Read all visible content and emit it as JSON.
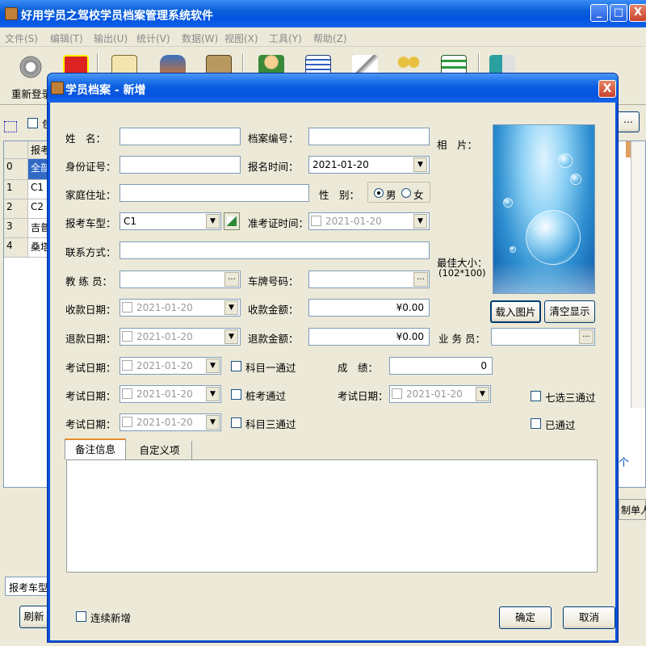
{
  "app": {
    "title": "好用学员之驾校学员档案管理系统软件",
    "window_controls": {
      "minimize": "_",
      "maximize": "□",
      "close": "X"
    },
    "menus": [
      "文件(S)",
      "编辑(T)",
      "输出(U)",
      "统计(V)",
      "数据(W)",
      "视图(X)",
      "工具(Y)",
      "帮助(Z)"
    ],
    "toolbar": {
      "relogin": "重新登录"
    }
  },
  "background": {
    "checkbox_label": "包",
    "ellipsis": "...",
    "grid_header": "报考",
    "grid_rows": [
      {
        "index": "0",
        "value": "全部"
      },
      {
        "index": "1",
        "value": "C1"
      },
      {
        "index": "2",
        "value": "C2"
      },
      {
        "index": "3",
        "value": "吉普"
      },
      {
        "index": "4",
        "value": "桑塔"
      }
    ],
    "right_link": "个",
    "right_header": "制单人",
    "bottom_field": "报考车型",
    "refresh_button": "刷新"
  },
  "dialog": {
    "title": "学员档案 - 新增",
    "close": "X",
    "fields": {
      "name": {
        "label": "姓　名：",
        "value": ""
      },
      "archive_no": {
        "label": "档案编号：",
        "value": ""
      },
      "id_card": {
        "label": "身份证号：",
        "value": ""
      },
      "signup_time": {
        "label": "报名时间：",
        "value": "2021-01-20"
      },
      "address": {
        "label": "家庭住址：",
        "value": ""
      },
      "gender": {
        "label": "性　别：",
        "options": [
          "男",
          "女"
        ],
        "selected": "男"
      },
      "car_type": {
        "label": "报考车型：",
        "value": "C1"
      },
      "permit_time": {
        "label": "准考证时间：",
        "value": "2021-01-20"
      },
      "contact": {
        "label": "联系方式：",
        "value": ""
      },
      "coach": {
        "label": "教 练 员：",
        "value": ""
      },
      "plate": {
        "label": "车牌号码：",
        "value": ""
      },
      "pay_date": {
        "label": "收款日期：",
        "value": "2021-01-20"
      },
      "pay_amount": {
        "label": "收款金额：",
        "value": "¥0.00"
      },
      "refund_date": {
        "label": "退款日期：",
        "value": "2021-01-20"
      },
      "refund_amount": {
        "label": "退款金额：",
        "value": "¥0.00"
      },
      "salesman": {
        "label": "业 务 员：",
        "value": ""
      },
      "exam1_date": {
        "label": "考试日期：",
        "value": "2021-01-20"
      },
      "subject1": {
        "label": "科目一通过"
      },
      "score": {
        "label": "成　绩：",
        "value": "0"
      },
      "exam2_date": {
        "label": "考试日期：",
        "value": "2021-01-20"
      },
      "pile": {
        "label": "桩考通过"
      },
      "exam4_date": {
        "label": "考试日期：",
        "value": "2021-01-20"
      },
      "seven_three": {
        "label": "七选三通过"
      },
      "exam3_date": {
        "label": "考试日期：",
        "value": "2021-01-20"
      },
      "subject3": {
        "label": "科目三通过"
      },
      "passed": {
        "label": "已通过"
      }
    },
    "photo": {
      "label": "相　片：",
      "best_size": "最佳大小：",
      "best_size_value": "(102*100)",
      "load_button": "载入图片",
      "clear_button": "清空显示"
    },
    "tabs": [
      "备注信息",
      "自定义项"
    ],
    "continuous_add": "连续新增",
    "ok_button": "确定",
    "cancel_button": "取消",
    "ellipsis": "...",
    "dropdown_arrow": "▼"
  }
}
